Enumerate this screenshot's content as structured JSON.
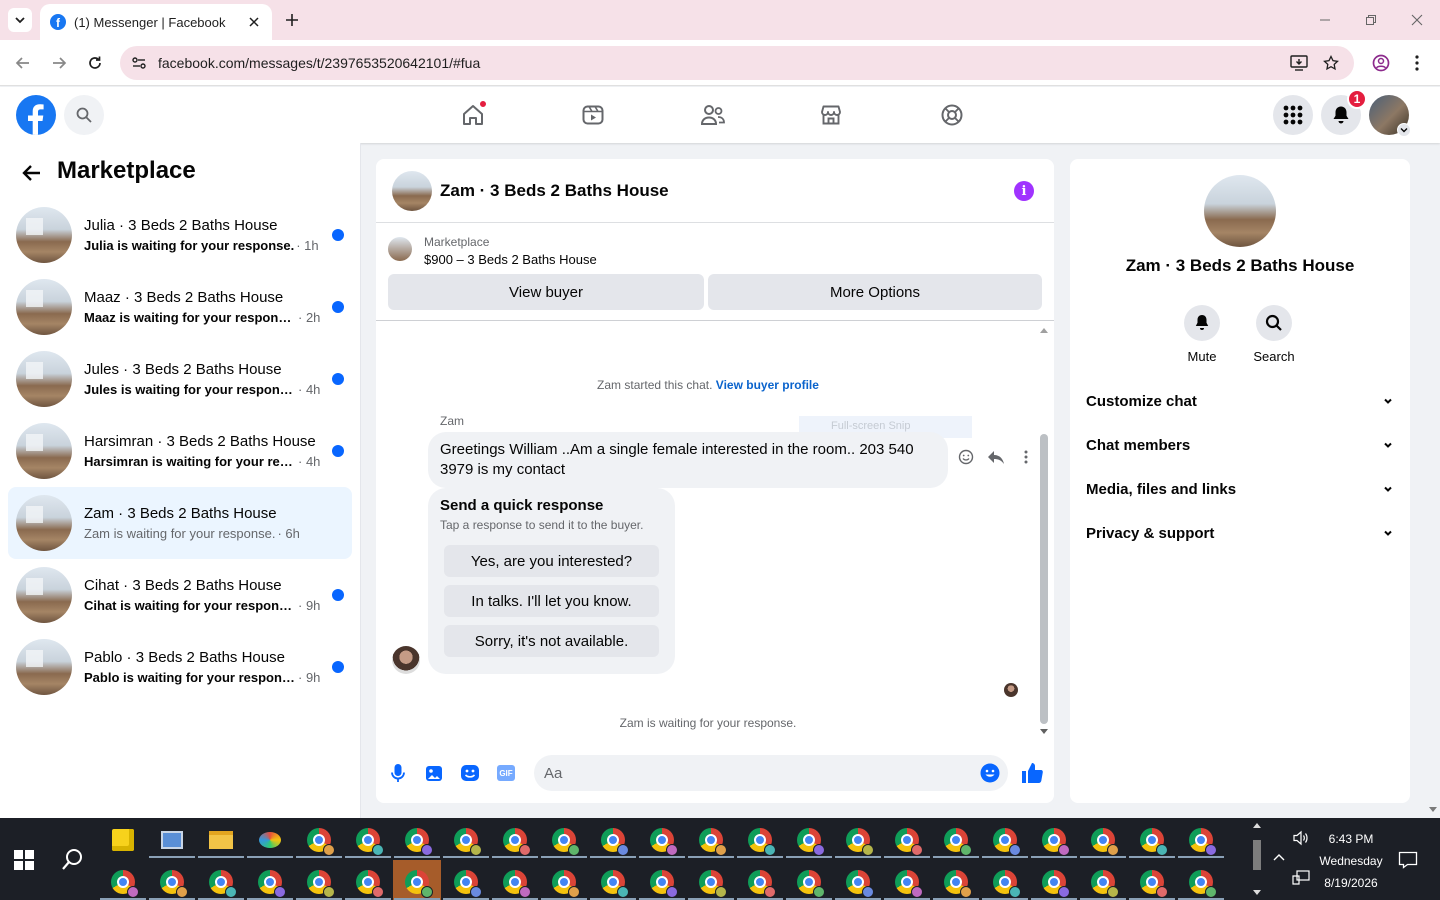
{
  "browser": {
    "tab_title": "(1) Messenger | Facebook",
    "url": "facebook.com/messages/t/2397653520642101/#fua"
  },
  "fbnav": {
    "notifications_count": "1"
  },
  "left": {
    "title": "Marketplace",
    "conversations": [
      {
        "name": "Julia · 3 Beds 2 Baths House",
        "message": "Julia is waiting for your response.",
        "time": "· 1h",
        "unread": true
      },
      {
        "name": "Maaz · 3 Beds 2 Baths House",
        "message": "Maaz is waiting for your response.",
        "time": "· 2h",
        "unread": true
      },
      {
        "name": "Jules · 3 Beds 2 Baths House",
        "message": "Jules is waiting for your response.",
        "time": "· 4h",
        "unread": true
      },
      {
        "name": "Harsimran · 3 Beds 2 Baths House",
        "message": "Harsimran is waiting for your resp...",
        "time": "· 4h",
        "unread": true
      },
      {
        "name": "Zam · 3 Beds 2 Baths House",
        "message": "Zam is waiting for your response.",
        "time": "· 6h",
        "unread": false
      },
      {
        "name": "Cihat · 3 Beds 2 Baths House",
        "message": "Cihat is waiting for your response.",
        "time": "· 9h",
        "unread": true
      },
      {
        "name": "Pablo · 3 Beds 2 Baths House",
        "message": "Pablo is waiting for your response.",
        "time": "· 9h",
        "unread": true
      }
    ]
  },
  "chat": {
    "title": "Zam · 3 Beds 2 Baths House",
    "listing_source": "Marketplace",
    "listing_title": "$900 – 3 Beds 2 Baths House",
    "view_buyer": "View buyer",
    "more_options": "More Options",
    "started_text": "Zam started this chat.",
    "view_profile": "View buyer profile",
    "sender": "Zam",
    "snip_overlay": "Full-screen Snip",
    "message": "Greetings William ..Am a single female interested in the room.. 203 540 3979 is my contact",
    "quick_title": "Send a quick response",
    "quick_sub": "Tap a response to send it to the buyer.",
    "quick_replies": [
      "Yes, are you interested?",
      "In talks. I'll let you know.",
      "Sorry, it's not available."
    ],
    "waiting": "Zam is waiting for your response.",
    "input_placeholder": "Aa"
  },
  "info": {
    "name": "Zam · 3 Beds 2 Baths House",
    "mute": "Mute",
    "search": "Search",
    "sections": [
      "Customize chat",
      "Chat members",
      "Media, files and links",
      "Privacy & support"
    ]
  },
  "taskbar": {
    "time": "6:43 PM",
    "day": "Wednesday",
    "date": "8/19/2026",
    "profile_colors": [
      "#e06a6a",
      "#5fb56b",
      "#6a8ae0",
      "#c06ac0",
      "#e0a04a",
      "#4ab5b5",
      "#8a6ae0",
      "#b5b54a"
    ]
  }
}
